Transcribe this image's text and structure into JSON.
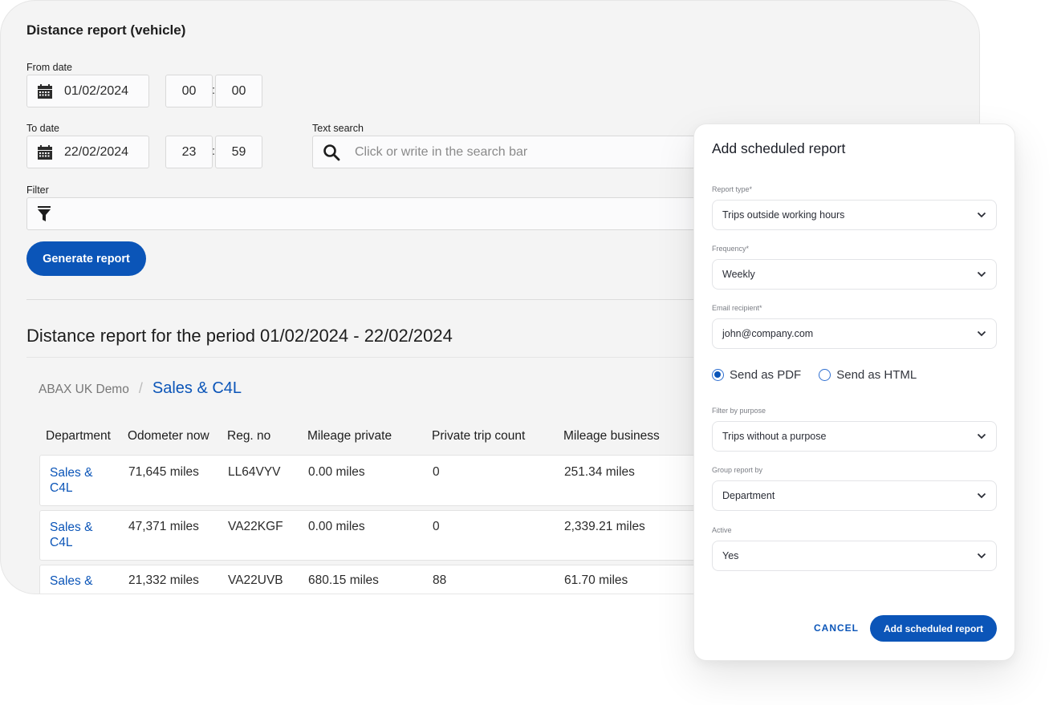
{
  "page": {
    "title": "Distance report (vehicle)",
    "from_date": {
      "label": "From date",
      "date": "01/02/2024",
      "hour": "00",
      "minute": "00"
    },
    "to_date": {
      "label": "To date",
      "date": "22/02/2024",
      "hour": "23",
      "minute": "59"
    },
    "time_separator": ":",
    "text_search": {
      "label": "Text search",
      "placeholder": "Click or write in the search bar"
    },
    "filter": {
      "label": "Filter"
    },
    "generate_button": "Generate report",
    "report_heading": "Distance report for the period 01/02/2024 - 22/02/2024",
    "breadcrumb": {
      "root": "ABAX UK Demo",
      "separator": "/",
      "current": "Sales & C4L"
    },
    "accent_color": "#0b55b8"
  },
  "table": {
    "columns": [
      "Department",
      "Odometer now",
      "Reg. no",
      "Mileage private",
      "Private trip count",
      "Mileage business"
    ],
    "rows": [
      {
        "department": "Sales & C4L",
        "odometer": "71,645 miles",
        "reg_no": "LL64VYV",
        "mileage_private": "0.00 miles",
        "private_trip_count": "0",
        "mileage_business": "251.34 miles"
      },
      {
        "department": "Sales & C4L",
        "odometer": "47,371 miles",
        "reg_no": "VA22KGF",
        "mileage_private": "0.00 miles",
        "private_trip_count": "0",
        "mileage_business": "2,339.21 miles"
      },
      {
        "department": "Sales &",
        "odometer": "21,332 miles",
        "reg_no": "VA22UVB",
        "mileage_private": "680.15 miles",
        "private_trip_count": "88",
        "mileage_business": "61.70 miles"
      }
    ]
  },
  "modal": {
    "title": "Add scheduled report",
    "report_type": {
      "label": "Report type*",
      "value": "Trips outside working hours"
    },
    "frequency": {
      "label": "Frequency*",
      "value": "Weekly"
    },
    "email_recipient": {
      "label": "Email recipient*",
      "value": "john@company.com"
    },
    "send_format": {
      "options": [
        {
          "label": "Send as PDF",
          "checked": true
        },
        {
          "label": "Send as HTML",
          "checked": false
        }
      ]
    },
    "filter_by_purpose": {
      "label": "Filter by purpose",
      "value": "Trips without a purpose"
    },
    "group_report_by": {
      "label": "Group report by",
      "value": "Department"
    },
    "active": {
      "label": "Active",
      "value": "Yes"
    },
    "cancel_button": "CANCEL",
    "submit_button": "Add scheduled report"
  }
}
